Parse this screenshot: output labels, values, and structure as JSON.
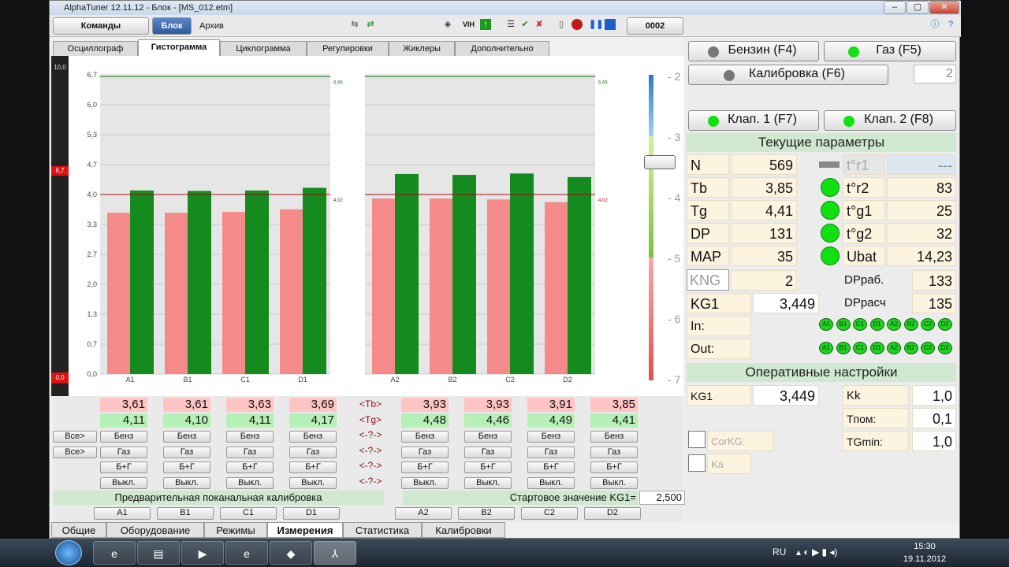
{
  "window": {
    "title": "AlphaTuner 12.11.12 - Блок - [MS_012.etm]"
  },
  "toolbar": {
    "commands": "Команды",
    "block": "Блок",
    "archive": "Архив",
    "counter": "0002",
    "vih": "VIH"
  },
  "tabs": [
    "Осциллограф",
    "Гистограмма",
    "Циклограмма",
    "Регулировки",
    "Жиклеры",
    "Дополнительно"
  ],
  "left_scale": {
    "top": "10,0",
    "mid": "6,7",
    "bottom": "0,0"
  },
  "chart_data": {
    "type": "bar",
    "y_ticks": [
      "6,7",
      "6,0",
      "5,3",
      "4,7",
      "4,0",
      "3,3",
      "2,7",
      "2,0",
      "1,3",
      "0,7",
      "0,0"
    ],
    "ylim": [
      0,
      6.7
    ],
    "panels": [
      {
        "categories": [
          "A1",
          "B1",
          "C1",
          "D1"
        ],
        "series": [
          {
            "name": "Tb",
            "values": [
              3.61,
              3.61,
              3.63,
              3.69
            ]
          },
          {
            "name": "Tg",
            "values": [
              4.11,
              4.1,
              4.11,
              4.17
            ]
          }
        ],
        "upper_line": 6.66,
        "upper_label": "6,66",
        "ref_line": 4.02,
        "ref_label": "4,02"
      },
      {
        "categories": [
          "A2",
          "B2",
          "C2",
          "D2"
        ],
        "series": [
          {
            "name": "Tb",
            "values": [
              3.93,
              3.93,
              3.91,
              3.85
            ]
          },
          {
            "name": "Tg",
            "values": [
              4.48,
              4.46,
              4.49,
              4.41
            ]
          }
        ],
        "upper_line": 6.66,
        "upper_label": "6,66",
        "ref_line": 4.02,
        "ref_label": "4,02"
      }
    ],
    "right_scale": [
      "2",
      "3",
      "4",
      "5",
      "6",
      "7"
    ]
  },
  "colors": {
    "tb": "#f48a8a",
    "tg": "#158a1e",
    "ref": "#9a1010",
    "upper": "#1e7a1e"
  },
  "values": {
    "tb": [
      "3,61",
      "3,61",
      "3,63",
      "3,69",
      "3,93",
      "3,93",
      "3,91",
      "3,85"
    ],
    "tg": [
      "4,11",
      "4,10",
      "4,11",
      "4,17",
      "4,48",
      "4,46",
      "4,49",
      "4,41"
    ],
    "tb_mid": "<Tb>",
    "tg_mid": "<Tg>",
    "q_mid": "<-?->"
  },
  "mode_buttons": {
    "all": "Все>",
    "benz": "Бенз",
    "gas": "Газ",
    "bg": "Б+Г",
    "off": "Выкл."
  },
  "calibration": {
    "label": "Предварительная поканальная калибровка",
    "start_label": "Стартовое значение KG1=",
    "start_value": "2,500",
    "channels": [
      "A1",
      "B1",
      "C1",
      "D1",
      "A2",
      "B2",
      "C2",
      "D2"
    ]
  },
  "right": {
    "benzin": "Бензин (F4)",
    "gaz": "Газ    (F5)",
    "kalibrovka": "Калибровка  (F6)",
    "kal_value": "2",
    "klap1": "Клап. 1 (F7)",
    "klap2": "Клап. 2 (F8)",
    "params_title": "Текущие параметры",
    "params": [
      {
        "k": "N",
        "v": "569",
        "k2": "t°r1",
        "v2": "---"
      },
      {
        "k": "Tb",
        "v": "3,85",
        "k2": "t°r2",
        "v2": "83"
      },
      {
        "k": "Tg",
        "v": "4,41",
        "k2": "t°g1",
        "v2": "25"
      },
      {
        "k": "DP",
        "v": "131",
        "k2": "t°g2",
        "v2": "32"
      },
      {
        "k": "MAP",
        "v": "35",
        "k2": "Ubat",
        "v2": "14,23"
      }
    ],
    "kng": "KNG",
    "kng_v": "2",
    "dprab": "DPраб.",
    "dprab_v": "133",
    "kg1": "KG1",
    "kg1_v": "3,449",
    "dprasch": "DPрасч",
    "dprasch_v": "135",
    "in": "In:",
    "out": "Out:",
    "io_labels": [
      "A1",
      "B1",
      "C1",
      "D1",
      "A2",
      "B2",
      "C2",
      "D2"
    ],
    "op_title": "Оперативные настройки",
    "op_kg1": "KG1",
    "op_kg1_v": "3,449",
    "kk": "Kk",
    "kk_v": "1,0",
    "tpom": "Tпом:",
    "tpom_v": "0,1",
    "tgmin": "TGmin:",
    "tgmin_v": "1,0",
    "corkg": "CorKG:",
    "ka": "Ka"
  },
  "bottom_tabs": [
    "Общие",
    "Оборудование",
    "Режимы",
    "Измерения",
    "Статистика",
    "Калибровки"
  ],
  "taskbar": {
    "lang": "RU",
    "time": "15:30",
    "date": "19.11.2012"
  }
}
